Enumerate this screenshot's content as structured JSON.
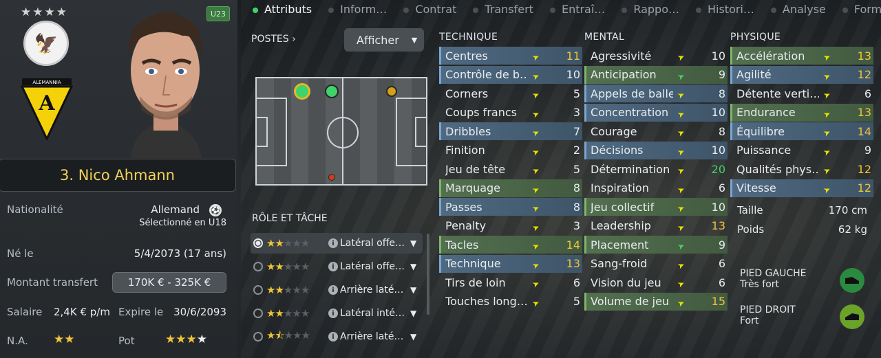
{
  "player": {
    "number_name": "3. Nico Ahmann",
    "stars_top": "★★★★",
    "age_badge": "U23",
    "club_text": "ALEMANNIA"
  },
  "info": {
    "nationality_label": "Nationalité",
    "nationality_value": "Allemand",
    "nationality_sub": "Sélectionné en U18",
    "born_label": "Né le",
    "born_value": "5/4/2073 (17 ans)",
    "transfer_label": "Montant transfert",
    "transfer_value": "170K € - 325K €",
    "salary_label": "Salaire",
    "salary_value": "2,4K € p/m",
    "expires_label": "Expire le",
    "expires_value": "30/6/2093",
    "na_label": "N.A.",
    "pot_label": "Pot",
    "na_stars": {
      "full": 2,
      "half": 0,
      "total": 2
    },
    "pot_stars": {
      "full": 3,
      "half": 0,
      "empty_white": 1
    }
  },
  "tabs": [
    "Attributs",
    "Inform…",
    "Contrat",
    "Transfert",
    "Entraî…",
    "Rappo…",
    "Histori…",
    "Analyse",
    "Forme"
  ],
  "positions": {
    "title": "POSTES",
    "title_chevron": "›",
    "show_label": "Afficher",
    "dots": [
      {
        "role": "main",
        "color": "#3fd36a"
      },
      {
        "role": "main",
        "color": "#3fd36a"
      },
      {
        "role": "alt",
        "color": "#d4a017"
      },
      {
        "role": "weak",
        "color": "#d23c1f"
      }
    ]
  },
  "roles": {
    "title": "RÔLE ET TÂCHE",
    "items": [
      {
        "label": "Latéral offe…",
        "stars_full": 2,
        "stars_half": 0,
        "selected": true
      },
      {
        "label": "Latéral offe…",
        "stars_full": 2,
        "stars_half": 0,
        "selected": false
      },
      {
        "label": "Arrière laté…",
        "stars_full": 2,
        "stars_half": 0,
        "selected": false
      },
      {
        "label": "Latéral inté…",
        "stars_full": 2,
        "stars_half": 0,
        "selected": false
      },
      {
        "label": "Arrière laté…",
        "stars_full": 1,
        "stars_half": 1,
        "selected": false
      }
    ]
  },
  "technique": {
    "title": "TECHNIQUE",
    "items": [
      {
        "name": "Centres",
        "value": "11",
        "hl": "b",
        "trend": "up-y"
      },
      {
        "name": "Contrôle de b…",
        "value": "10",
        "hl": "b",
        "trend": "up-y"
      },
      {
        "name": "Corners",
        "value": "5",
        "hl": "",
        "trend": "up-y"
      },
      {
        "name": "Coups francs",
        "value": "3",
        "hl": "",
        "trend": "up-y"
      },
      {
        "name": "Dribbles",
        "value": "7",
        "hl": "b",
        "trend": "up-y"
      },
      {
        "name": "Finition",
        "value": "2",
        "hl": "",
        "trend": "up-y"
      },
      {
        "name": "Jeu de tête",
        "value": "5",
        "hl": "",
        "trend": "up-y"
      },
      {
        "name": "Marquage",
        "value": "8",
        "hl": "g",
        "trend": "up-y"
      },
      {
        "name": "Passes",
        "value": "8",
        "hl": "b",
        "trend": "up-y"
      },
      {
        "name": "Penalty",
        "value": "3",
        "hl": "",
        "trend": "up-y"
      },
      {
        "name": "Tacles",
        "value": "14",
        "hl": "g",
        "trend": "up-y"
      },
      {
        "name": "Technique",
        "value": "13",
        "hl": "b",
        "trend": "up-y"
      },
      {
        "name": "Tirs de loin",
        "value": "6",
        "hl": "",
        "trend": "up-y"
      },
      {
        "name": "Touches long…",
        "value": "5",
        "hl": "",
        "trend": "up-y"
      }
    ]
  },
  "mental": {
    "title": "MENTAL",
    "items": [
      {
        "name": "Agressivité",
        "value": "10",
        "hl": "",
        "trend": "up-y"
      },
      {
        "name": "Anticipation",
        "value": "9",
        "hl": "g",
        "trend": "up-g"
      },
      {
        "name": "Appels de balle",
        "value": "8",
        "hl": "b",
        "trend": "up-y"
      },
      {
        "name": "Concentration",
        "value": "10",
        "hl": "b",
        "trend": "up-y"
      },
      {
        "name": "Courage",
        "value": "8",
        "hl": "",
        "trend": "up-y"
      },
      {
        "name": "Décisions",
        "value": "10",
        "hl": "b",
        "trend": "up-y"
      },
      {
        "name": "Détermination",
        "value": "20",
        "hl": "",
        "trend": "up-y"
      },
      {
        "name": "Inspiration",
        "value": "6",
        "hl": "",
        "trend": "up-y"
      },
      {
        "name": "Jeu collectif",
        "value": "10",
        "hl": "g",
        "trend": "up-y"
      },
      {
        "name": "Leadership",
        "value": "13",
        "hl": "",
        "trend": "up-y"
      },
      {
        "name": "Placement",
        "value": "9",
        "hl": "g",
        "trend": "up-g"
      },
      {
        "name": "Sang-froid",
        "value": "6",
        "hl": "",
        "trend": "up-y"
      },
      {
        "name": "Vision du jeu",
        "value": "6",
        "hl": "",
        "trend": "up-y"
      },
      {
        "name": "Volume de jeu",
        "value": "15",
        "hl": "g",
        "trend": "up-y"
      }
    ]
  },
  "physique": {
    "title": "PHYSIQUE",
    "items": [
      {
        "name": "Accélération",
        "value": "13",
        "hl": "g",
        "trend": "up-y"
      },
      {
        "name": "Agilité",
        "value": "12",
        "hl": "b",
        "trend": "up-y"
      },
      {
        "name": "Détente verti…",
        "value": "6",
        "hl": "",
        "trend": "up-y"
      },
      {
        "name": "Endurance",
        "value": "13",
        "hl": "g",
        "trend": "up-y"
      },
      {
        "name": "Équilibre",
        "value": "14",
        "hl": "b",
        "trend": "up-y"
      },
      {
        "name": "Puissance",
        "value": "9",
        "hl": "",
        "trend": "up-y"
      },
      {
        "name": "Qualités phys…",
        "value": "12",
        "hl": "",
        "trend": "up-y"
      },
      {
        "name": "Vitesse",
        "value": "12",
        "hl": "b",
        "trend": "up-y"
      }
    ],
    "height_label": "Taille",
    "height_value": "170 cm",
    "weight_label": "Poids",
    "weight_value": "62 kg"
  },
  "feet": {
    "left_label": "PIED GAUCHE",
    "left_value": "Très fort",
    "right_label": "PIED DROIT",
    "right_value": "Fort"
  },
  "colors": {
    "accent_gold": "#f0c53a",
    "value_highlight": "#f0c53a",
    "value_max": "#3fd36a",
    "hl_blue": "#4f6a82",
    "hl_green": "#53704f"
  }
}
